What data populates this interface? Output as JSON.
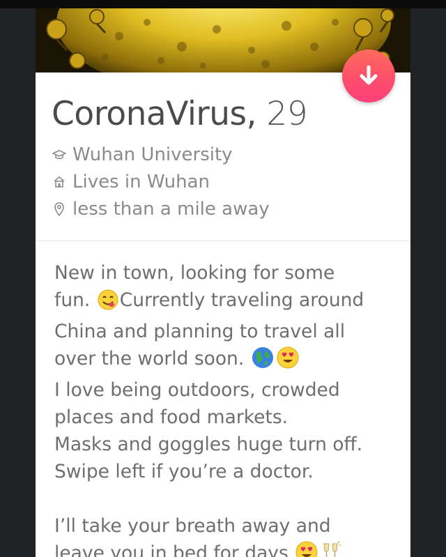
{
  "profile": {
    "name": "CoronaVirus,",
    "age": "29",
    "school": "Wuhan University",
    "lives": "Lives in Wuhan",
    "distance": "less than a mile away"
  },
  "bio": {
    "line1": "New in town, looking for some",
    "line2a": "fun.",
    "line2b": "Currently traveling around",
    "line3": "China and planning to travel all",
    "line4": "over the world soon.",
    "line5": "I love being outdoors, crowded",
    "line6": "places and food markets.",
    "line7": "Masks and goggles huge turn off.",
    "line8": "Swipe left if you’re a doctor.",
    "line9": "I’ll take your breath away and",
    "line10": "leave you in bed for days"
  },
  "icons": {
    "collapse": "arrow-down-icon",
    "school": "graduation-cap-icon",
    "home": "home-icon",
    "location": "location-pin-icon"
  },
  "colors": {
    "accent": "#fd4f6b",
    "name_text": "#4b4b4b",
    "info_text": "#8a8a8a",
    "bio_text": "#6e6e6e",
    "background": "#212225"
  }
}
